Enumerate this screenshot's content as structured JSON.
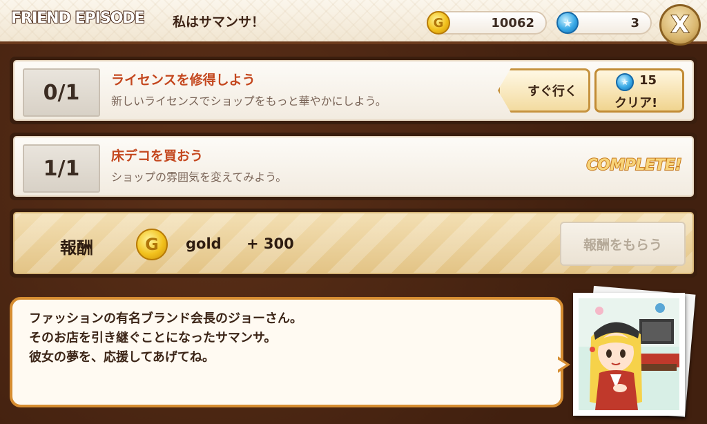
{
  "header": {
    "episode_tag": "FRIEND EPISODE",
    "title": "私はサマンサ！",
    "gold_icon": "G",
    "gold": "10062",
    "gem_icon": "★",
    "gems": "3",
    "close_label": "X"
  },
  "missions": [
    {
      "progress": "0/1",
      "title": "ライセンスを修得しよう",
      "description": "新しいライセンスでショップをもっと華やかにしよう。",
      "go_label": "すぐ行く",
      "clear_cost": "15",
      "clear_label": "クリア!"
    },
    {
      "progress": "1/1",
      "title": "床デコを買おう",
      "description": "ショップの雰囲気を変えてみよう。",
      "status": "COMPLETE!"
    }
  ],
  "reward": {
    "label": "報酬",
    "coin_icon": "G",
    "item": "gold",
    "amount": "+ 300",
    "claim_label": "報酬をもらう"
  },
  "dialogue": {
    "lines": [
      "ファッションの有名ブランド会長のジョーさん。",
      "そのお店を引き継ぐことになったサマンサ。",
      "彼女の夢を、応援してあげてね。"
    ]
  },
  "colors": {
    "accent_title": "#c4471e",
    "frame_brown": "#3a1e0e",
    "bubble_border": "#d68d31"
  }
}
